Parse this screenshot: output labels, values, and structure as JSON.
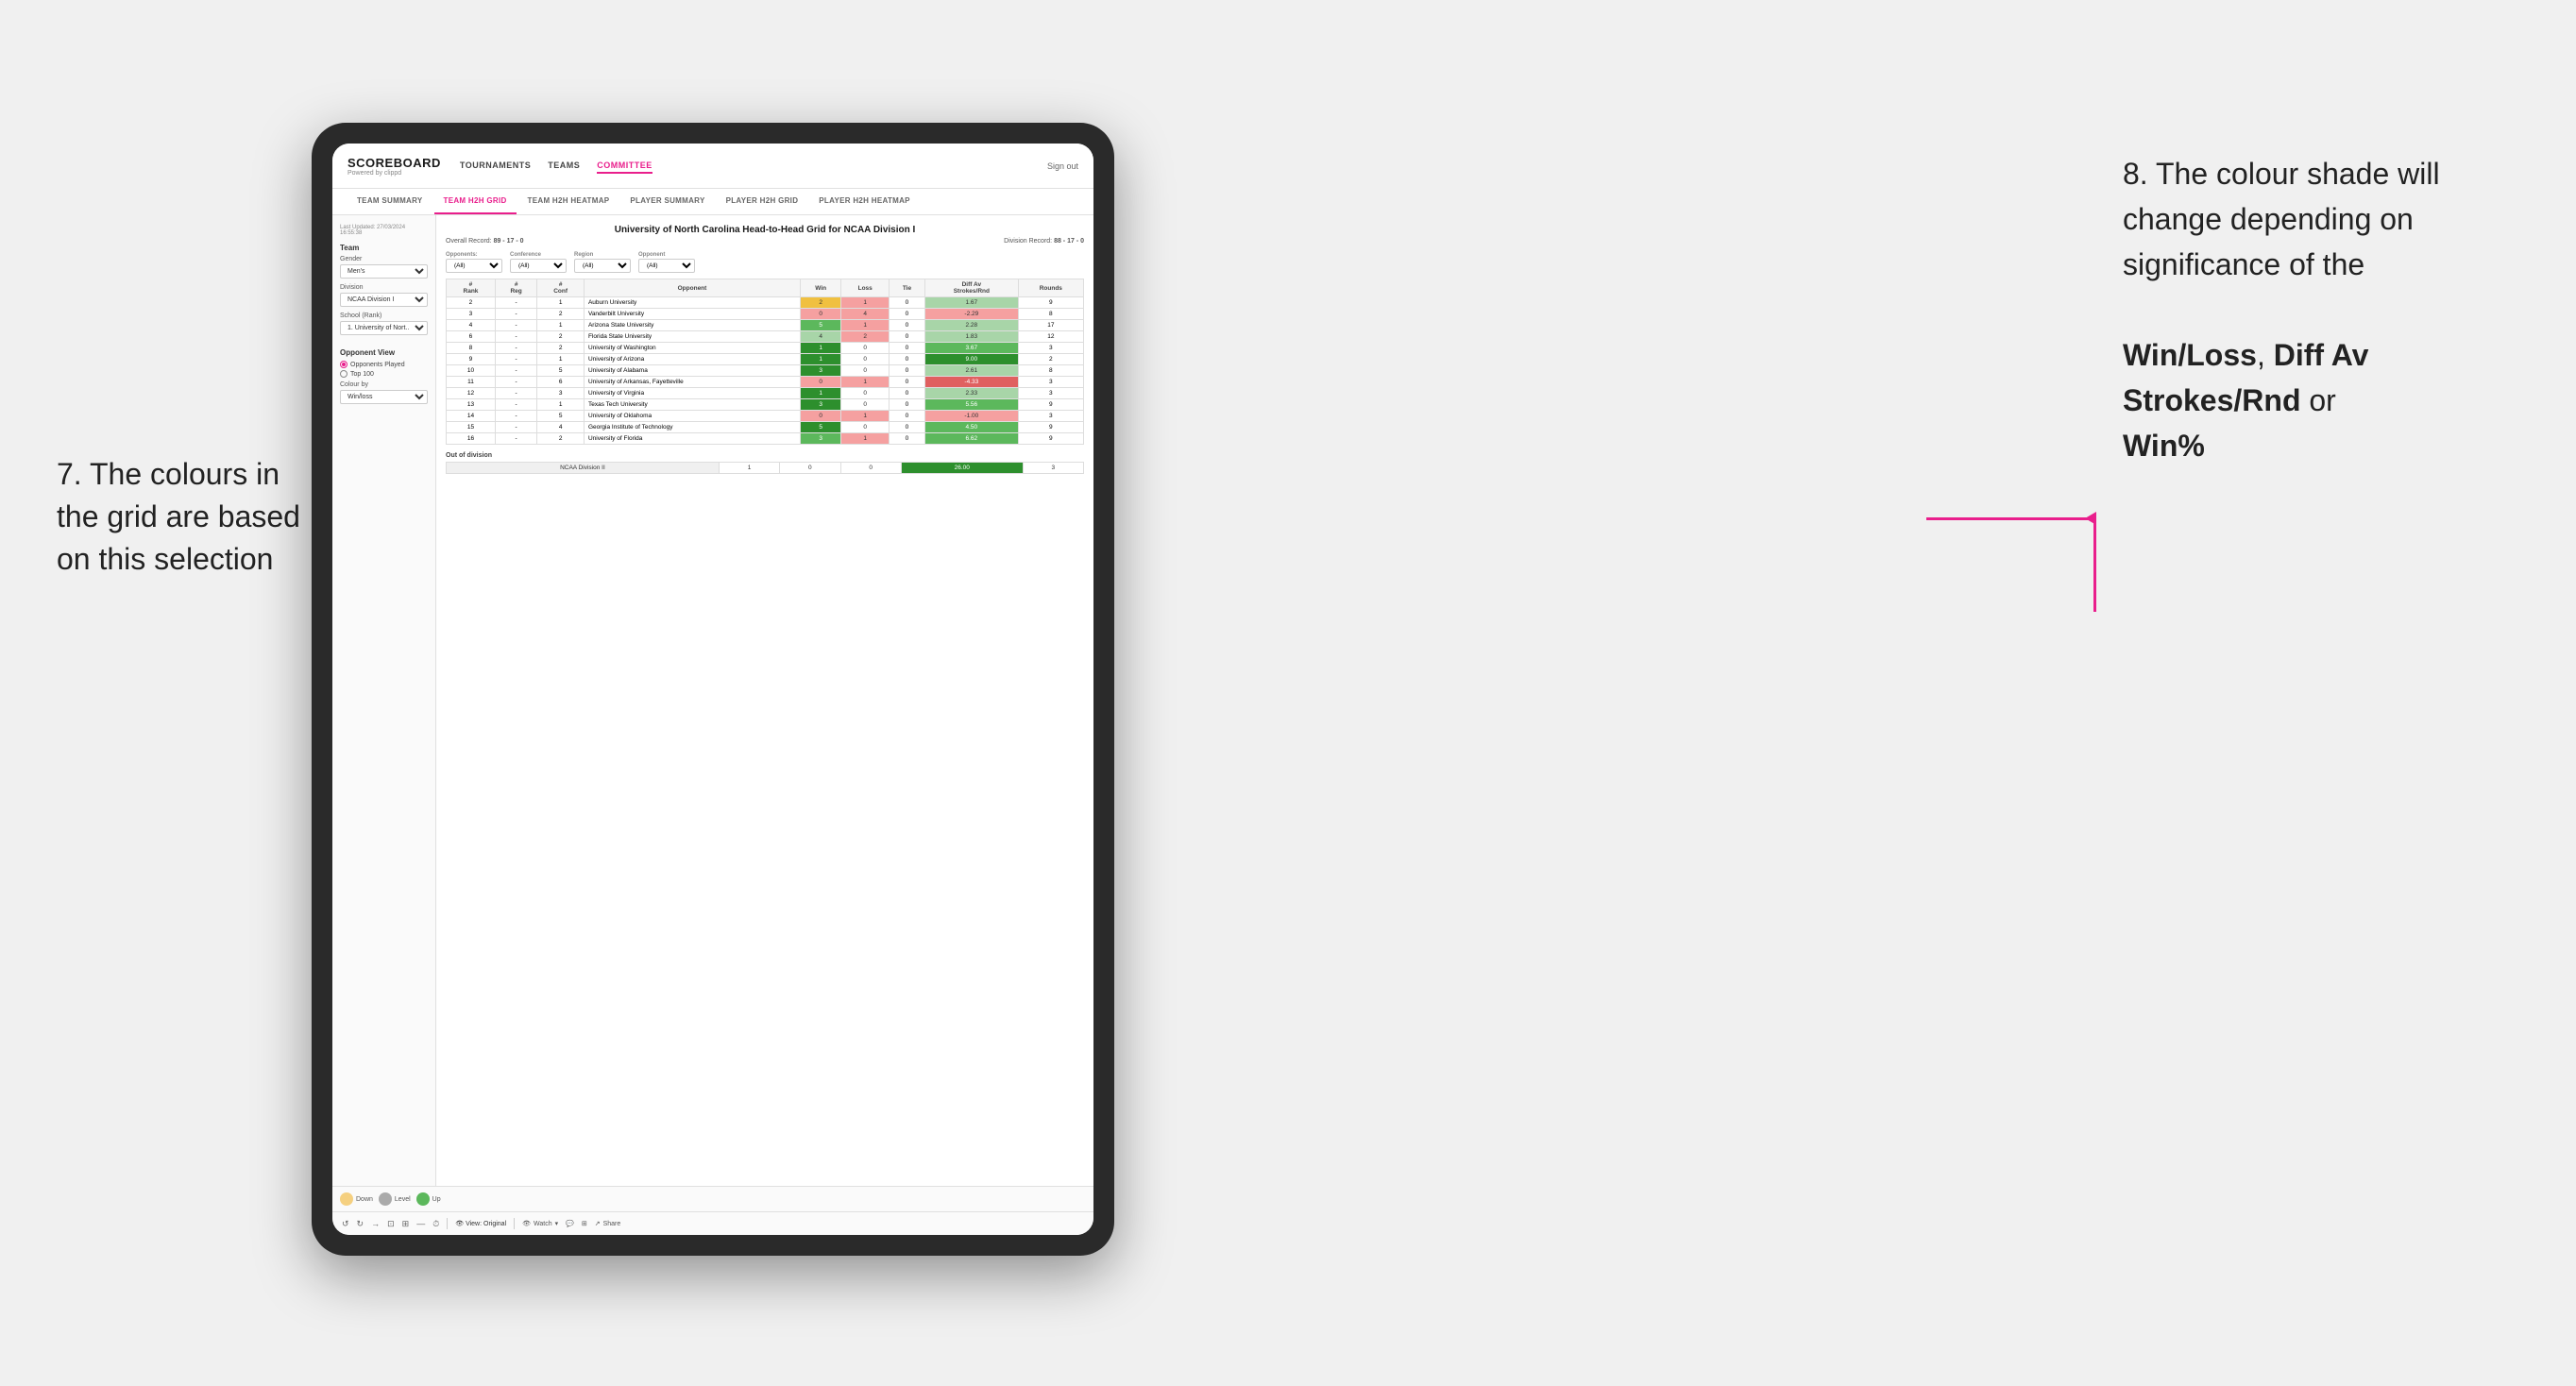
{
  "annotations": {
    "left_title": "7. The colours in the grid are based on this selection",
    "right_title": "8. The colour shade will change depending on significance of the",
    "right_bold1": "Win/Loss",
    "right_comma": ", ",
    "right_bold2": "Diff Av Strokes/Rnd",
    "right_or": " or",
    "right_bold3": "Win%"
  },
  "header": {
    "logo": "SCOREBOARD",
    "logo_sub": "Powered by clippd",
    "nav_items": [
      "TOURNAMENTS",
      "TEAMS",
      "COMMITTEE"
    ],
    "sign_out": "Sign out"
  },
  "sub_nav": {
    "items": [
      "TEAM SUMMARY",
      "TEAM H2H GRID",
      "TEAM H2H HEATMAP",
      "PLAYER SUMMARY",
      "PLAYER H2H GRID",
      "PLAYER H2H HEATMAP"
    ],
    "active": "TEAM H2H GRID"
  },
  "sidebar": {
    "timestamp": "Last Updated: 27/03/2024\n16:55:38",
    "team_section": "Team",
    "gender_label": "Gender",
    "gender_value": "Men's",
    "division_label": "Division",
    "division_value": "NCAA Division I",
    "school_label": "School (Rank)",
    "school_value": "1. University of Nort...",
    "opponent_view_label": "Opponent View",
    "opponent_options": [
      "Opponents Played",
      "Top 100"
    ],
    "opponent_selected": "Opponents Played",
    "colour_by_label": "Colour by",
    "colour_by_value": "Win/loss"
  },
  "legend": {
    "items": [
      {
        "label": "Down",
        "color": "#f5d080"
      },
      {
        "label": "Level",
        "color": "#aaaaaa"
      },
      {
        "label": "Up",
        "color": "#5cb85c"
      }
    ]
  },
  "grid": {
    "title": "University of North Carolina Head-to-Head Grid for NCAA Division I",
    "overall_record": "89 - 17 - 0",
    "division_record": "88 - 17 - 0",
    "filters": {
      "opponents_label": "Opponents:",
      "opponents_value": "(All)",
      "conference_label": "Conference",
      "conference_value": "(All)",
      "region_label": "Region",
      "region_value": "(All)",
      "opponent_label": "Opponent",
      "opponent_value": "(All)"
    },
    "columns": [
      "#\nRank",
      "#\nReg",
      "#\nConf",
      "Opponent",
      "Win",
      "Loss",
      "Tie",
      "Diff Av\nStrokes/Rnd",
      "Rounds"
    ],
    "rows": [
      {
        "rank": "2",
        "reg": "-",
        "conf": "1",
        "opponent": "Auburn University",
        "win": "2",
        "loss": "1",
        "tie": "0",
        "diff": "1.67",
        "rounds": "9",
        "win_color": "yellow",
        "diff_color": "green_light"
      },
      {
        "rank": "3",
        "reg": "-",
        "conf": "2",
        "opponent": "Vanderbilt University",
        "win": "0",
        "loss": "4",
        "tie": "0",
        "diff": "-2.29",
        "rounds": "8",
        "win_color": "red_light",
        "diff_color": "red_light"
      },
      {
        "rank": "4",
        "reg": "-",
        "conf": "1",
        "opponent": "Arizona State University",
        "win": "5",
        "loss": "1",
        "tie": "0",
        "diff": "2.28",
        "rounds": "17",
        "win_color": "green_med",
        "diff_color": "green_light"
      },
      {
        "rank": "6",
        "reg": "-",
        "conf": "2",
        "opponent": "Florida State University",
        "win": "4",
        "loss": "2",
        "tie": "0",
        "diff": "1.83",
        "rounds": "12",
        "win_color": "green_light",
        "diff_color": "green_light"
      },
      {
        "rank": "8",
        "reg": "-",
        "conf": "2",
        "opponent": "University of Washington",
        "win": "1",
        "loss": "0",
        "tie": "0",
        "diff": "3.67",
        "rounds": "3",
        "win_color": "green_dark",
        "diff_color": "green_med"
      },
      {
        "rank": "9",
        "reg": "-",
        "conf": "1",
        "opponent": "University of Arizona",
        "win": "1",
        "loss": "0",
        "tie": "0",
        "diff": "9.00",
        "rounds": "2",
        "win_color": "green_dark",
        "diff_color": "green_dark"
      },
      {
        "rank": "10",
        "reg": "-",
        "conf": "5",
        "opponent": "University of Alabama",
        "win": "3",
        "loss": "0",
        "tie": "0",
        "diff": "2.61",
        "rounds": "8",
        "win_color": "green_dark",
        "diff_color": "green_light"
      },
      {
        "rank": "11",
        "reg": "-",
        "conf": "6",
        "opponent": "University of Arkansas, Fayetteville",
        "win": "0",
        "loss": "1",
        "tie": "0",
        "diff": "-4.33",
        "rounds": "3",
        "win_color": "red_light",
        "diff_color": "red_med"
      },
      {
        "rank": "12",
        "reg": "-",
        "conf": "3",
        "opponent": "University of Virginia",
        "win": "1",
        "loss": "0",
        "tie": "0",
        "diff": "2.33",
        "rounds": "3",
        "win_color": "green_dark",
        "diff_color": "green_light"
      },
      {
        "rank": "13",
        "reg": "-",
        "conf": "1",
        "opponent": "Texas Tech University",
        "win": "3",
        "loss": "0",
        "tie": "0",
        "diff": "5.56",
        "rounds": "9",
        "win_color": "green_dark",
        "diff_color": "green_med"
      },
      {
        "rank": "14",
        "reg": "-",
        "conf": "5",
        "opponent": "University of Oklahoma",
        "win": "0",
        "loss": "1",
        "tie": "0",
        "diff": "-1.00",
        "rounds": "3",
        "win_color": "red_light",
        "diff_color": "red_light"
      },
      {
        "rank": "15",
        "reg": "-",
        "conf": "4",
        "opponent": "Georgia Institute of Technology",
        "win": "5",
        "loss": "0",
        "tie": "0",
        "diff": "4.50",
        "rounds": "9",
        "win_color": "green_dark",
        "diff_color": "green_med"
      },
      {
        "rank": "16",
        "reg": "-",
        "conf": "2",
        "opponent": "University of Florida",
        "win": "3",
        "loss": "1",
        "tie": "0",
        "diff": "6.62",
        "rounds": "9",
        "win_color": "green_med",
        "diff_color": "green_med"
      }
    ],
    "out_of_division_label": "Out of division",
    "out_of_division_rows": [
      {
        "division": "NCAA Division II",
        "win": "1",
        "loss": "0",
        "tie": "0",
        "diff": "26.00",
        "rounds": "3"
      }
    ]
  },
  "toolbar": {
    "view_label": "View: Original",
    "watch_label": "Watch",
    "share_label": "Share"
  }
}
